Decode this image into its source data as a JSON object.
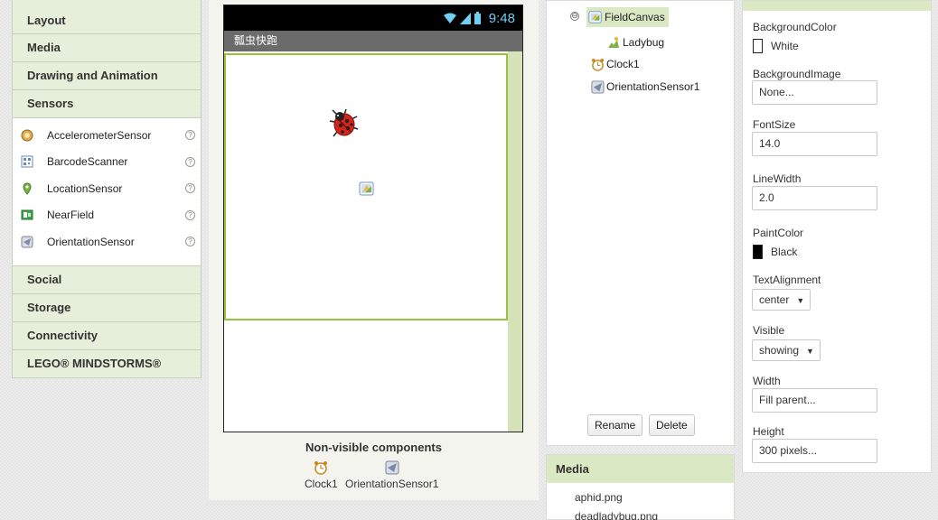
{
  "palette": {
    "drawers_top": [
      "Layout",
      "Media",
      "Drawing and Animation",
      "Sensors"
    ],
    "sensors": [
      {
        "label": "AccelerometerSensor",
        "icon": "accelerometer-icon"
      },
      {
        "label": "BarcodeScanner",
        "icon": "barcode-icon"
      },
      {
        "label": "LocationSensor",
        "icon": "location-pin-icon"
      },
      {
        "label": "NearField",
        "icon": "nfc-icon"
      },
      {
        "label": "OrientationSensor",
        "icon": "orientation-icon"
      }
    ],
    "help_glyph": "?",
    "drawers_bottom": [
      "Social",
      "Storage",
      "Connectivity",
      "LEGO® MINDSTORMS®"
    ]
  },
  "viewer": {
    "time": "9:48",
    "screen_title": "瓢虫快跑",
    "nonvisible_title": "Non-visible components",
    "nonvisible": [
      {
        "label": "Clock1",
        "icon": "clock-icon"
      },
      {
        "label": "OrientationSensor1",
        "icon": "orientation-icon"
      }
    ]
  },
  "components": {
    "collapse_glyph": "⊖",
    "tree": {
      "canvas": "FieldCanvas",
      "sprite": "Ladybug",
      "clock": "Clock1",
      "orientation": "OrientationSensor1"
    },
    "rename_label": "Rename",
    "delete_label": "Delete"
  },
  "media": {
    "title": "Media",
    "files": [
      "aphid.png",
      "deadladybug.png"
    ]
  },
  "properties": {
    "background_color_label": "BackgroundColor",
    "background_color_value": "White",
    "background_image_label": "BackgroundImage",
    "background_image_value": "None...",
    "font_size_label": "FontSize",
    "font_size_value": "14.0",
    "line_width_label": "LineWidth",
    "line_width_value": "2.0",
    "paint_color_label": "PaintColor",
    "paint_color_value": "Black",
    "text_alignment_label": "TextAlignment",
    "text_alignment_value": "center",
    "visible_label": "Visible",
    "visible_value": "showing",
    "width_label": "Width",
    "width_value": "Fill parent...",
    "height_label": "Height",
    "height_value": "300 pixels..."
  },
  "colors": {
    "accent_green": "#9ac23c",
    "drawer_bg": "#e6efd9",
    "selected_bg": "#dbe8c4",
    "status_bar": "#000000",
    "title_bar": "#6b6b6b"
  }
}
